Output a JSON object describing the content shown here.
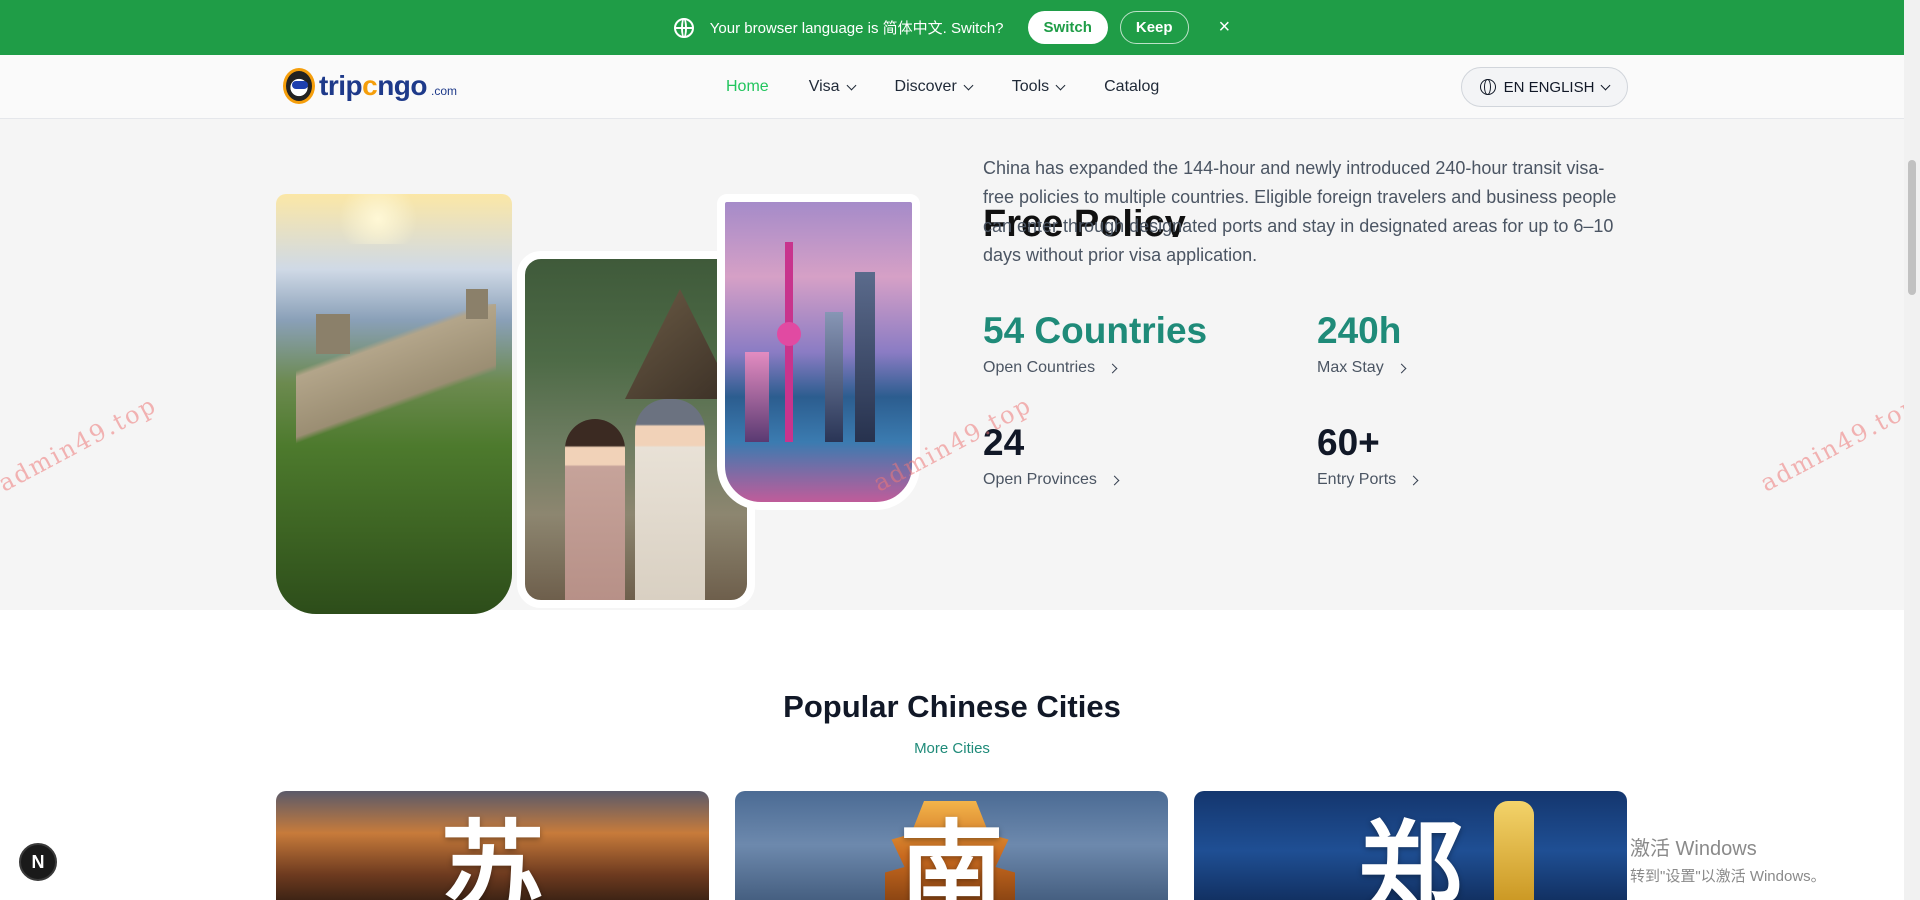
{
  "language_banner": {
    "message": "Your browser language is 简体中文. Switch?",
    "switch_label": "Switch",
    "keep_label": "Keep",
    "close_symbol": "×",
    "background_color": "#1f9d47"
  },
  "navbar": {
    "logo_text_part1": "trip",
    "logo_text_part2": "c",
    "logo_text_part3": "ngo",
    "logo_suffix": ".com",
    "items": [
      {
        "label": "Home",
        "active": true
      },
      {
        "label": "Visa",
        "has_dropdown": true
      },
      {
        "label": "Discover",
        "has_dropdown": true
      },
      {
        "label": "Tools",
        "has_dropdown": true
      },
      {
        "label": "Catalog"
      }
    ],
    "language_selector": "EN ENGLISH"
  },
  "visa_section": {
    "title_partial": "Free Policy",
    "description": "China has expanded the 144-hour and newly introduced 240-hour transit visa-free policies to multiple countries. Eligible foreign travelers and business people can enter through designated ports and stay in designated areas for up to 6–10 days without prior visa application.",
    "stats": [
      {
        "value": "54 Countries",
        "label": "Open Countries",
        "color": "#1f8b79"
      },
      {
        "value": "240h",
        "label": "Max Stay",
        "color": "#1f8b79"
      },
      {
        "value": "24",
        "label": "Open Provinces",
        "color": "#111827"
      },
      {
        "value": "60+",
        "label": "Entry Ports",
        "color": "#111827"
      }
    ]
  },
  "cities": {
    "title": "Popular Chinese Cities",
    "more_label": "More Cities",
    "cards": [
      {
        "char": "苏"
      },
      {
        "char": "南"
      },
      {
        "char": "郑"
      }
    ]
  },
  "watermark": "admin49.top",
  "windows_activation": {
    "title": "激活 Windows",
    "subtitle": "转到\"设置\"以激活 Windows。"
  },
  "next_badge": "N",
  "icons": [
    "globe-icon",
    "close-icon",
    "chevron-down-icon",
    "chevron-right-icon"
  ]
}
